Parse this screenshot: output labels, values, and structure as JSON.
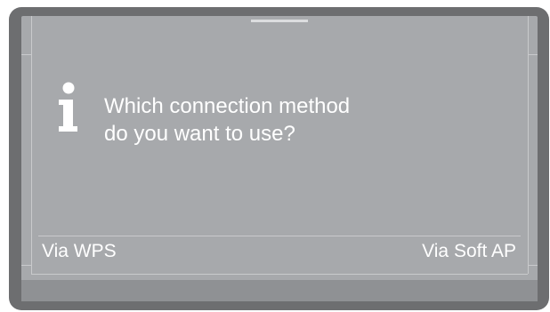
{
  "dialog": {
    "message_line1": "Which connection method",
    "message_line2": "do you want to use?",
    "icon": "info-icon"
  },
  "softkeys": {
    "left_label": "Via WPS",
    "right_label": "Via Soft AP"
  },
  "colors": {
    "bezel": "#6d6e70",
    "screen": "#a7a9ac",
    "text": "#ffffff",
    "lines": "#c9cacc"
  }
}
